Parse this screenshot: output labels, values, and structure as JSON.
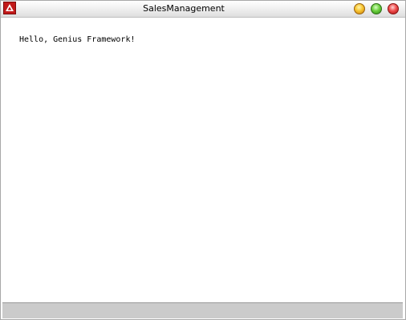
{
  "window": {
    "title": "SalesManagement",
    "app_icon": "red-app-icon",
    "buttons": {
      "minimize": "yellow-circle-icon",
      "maximize": "green-circle-icon",
      "close": "red-circle-icon"
    }
  },
  "content": {
    "message": "Hello, Genius Framework!"
  },
  "statusbar": {
    "text": ""
  },
  "colors": {
    "status_bar": "#cbcbcb",
    "app_icon": "#c21a1a"
  }
}
